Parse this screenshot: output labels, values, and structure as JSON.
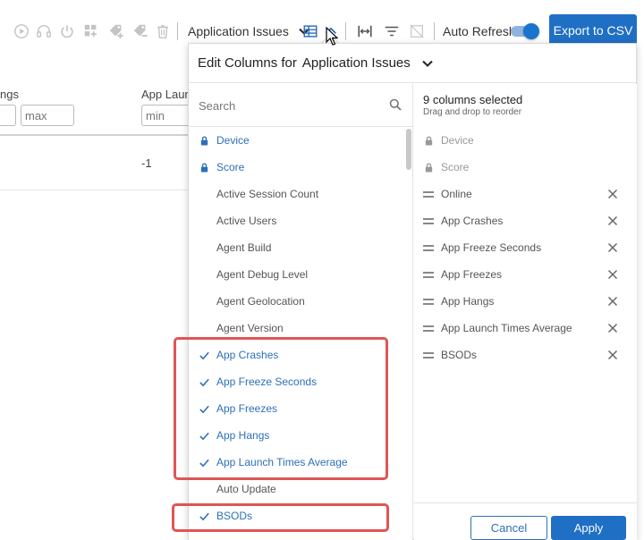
{
  "toolbar": {
    "icons": [
      "play-icon",
      "headset-icon",
      "power-icon",
      "add-widget-icon",
      "tag-add-icon",
      "tag-remove-icon",
      "trash-icon"
    ],
    "view_label": "Application Issues",
    "auto_refresh_label": "Auto Refresh",
    "auto_refresh_on": true,
    "export_label": "Export to CSV"
  },
  "background_table": {
    "col1_header": "ngs",
    "col2_header": "App Launc",
    "filter_max_placeholder": "max",
    "filter_min_placeholder": "min",
    "row1_value": "-1"
  },
  "popup": {
    "title_prefix": "Edit Columns for",
    "title_view": "Application Issues",
    "search_placeholder": "Search",
    "available": [
      {
        "label": "Device",
        "state": "locked"
      },
      {
        "label": "Score",
        "state": "locked"
      },
      {
        "label": "Active Session Count",
        "state": "none"
      },
      {
        "label": "Active Users",
        "state": "none"
      },
      {
        "label": "Agent Build",
        "state": "none"
      },
      {
        "label": "Agent Debug Level",
        "state": "none"
      },
      {
        "label": "Agent Geolocation",
        "state": "none"
      },
      {
        "label": "Agent Version",
        "state": "none"
      },
      {
        "label": "App Crashes",
        "state": "checked"
      },
      {
        "label": "App Freeze Seconds",
        "state": "checked"
      },
      {
        "label": "App Freezes",
        "state": "checked"
      },
      {
        "label": "App Hangs",
        "state": "checked"
      },
      {
        "label": "App Launch Times Average",
        "state": "checked"
      },
      {
        "label": "Auto Update",
        "state": "none"
      },
      {
        "label": "BSODs",
        "state": "checked"
      }
    ],
    "selected_count_text": "9 columns selected",
    "selected_hint": "Drag and drop to reorder",
    "selected": [
      {
        "label": "Device",
        "locked": true
      },
      {
        "label": "Score",
        "locked": true
      },
      {
        "label": "Online",
        "locked": false
      },
      {
        "label": "App Crashes",
        "locked": false
      },
      {
        "label": "App Freeze Seconds",
        "locked": false
      },
      {
        "label": "App Freezes",
        "locked": false
      },
      {
        "label": "App Hangs",
        "locked": false
      },
      {
        "label": "App Launch Times Average",
        "locked": false
      },
      {
        "label": "BSODs",
        "locked": false
      }
    ],
    "cancel_label": "Cancel",
    "apply_label": "Apply"
  },
  "colors": {
    "accent": "#1f6fc5",
    "link": "#2d6fb8",
    "highlight": "#e05555"
  }
}
